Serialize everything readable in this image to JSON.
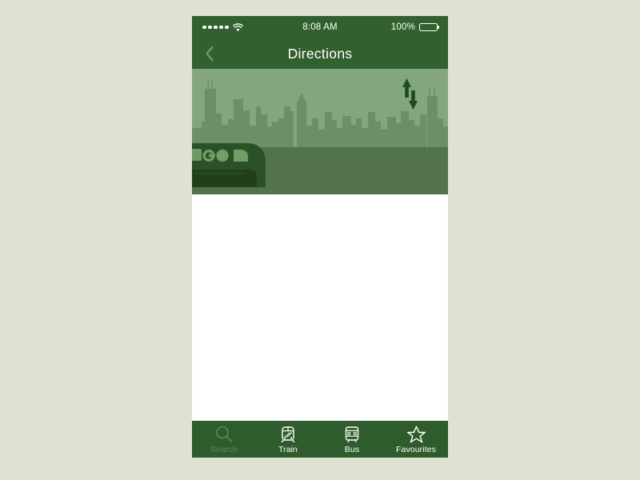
{
  "theme": {
    "page_background": "#dde3d0",
    "nav_green": "#33602f",
    "tabbar_green": "#2f5c2c",
    "accent_light_green": "#6fa05f",
    "inactive_tab_green": "#5f8a58",
    "hero_sky": "#84a67e",
    "hero_buildings": "#6b8f66",
    "hero_ground": "#53734d",
    "train_body": "#2b5226",
    "train_dark": "#20401c",
    "arrow_icon_color": "#1e4a1c",
    "content_background": "#ffffff"
  },
  "status_bar": {
    "signal_dots": 5,
    "signal_icon": "signal-dots-icon",
    "wifi_icon": "wifi-icon",
    "time": "8:08 AM",
    "battery_percent": "100%",
    "battery_icon": "battery-full-icon",
    "battery_fill_pct": 100
  },
  "nav_bar": {
    "back_icon": "chevron-left-icon",
    "title": "Directions"
  },
  "hero": {
    "alt": "city-skyline-with-go-train",
    "swap_icon": "up-down-arrows-icon",
    "train_logo": "go-transit-logo"
  },
  "tab_bar": {
    "tabs": [
      {
        "label": "Search",
        "icon": "search-icon",
        "active": false
      },
      {
        "label": "Train",
        "icon": "train-icon",
        "active": true
      },
      {
        "label": "Bus",
        "icon": "bus-icon",
        "active": true
      },
      {
        "label": "Favourites",
        "icon": "star-icon",
        "active": true
      }
    ]
  }
}
